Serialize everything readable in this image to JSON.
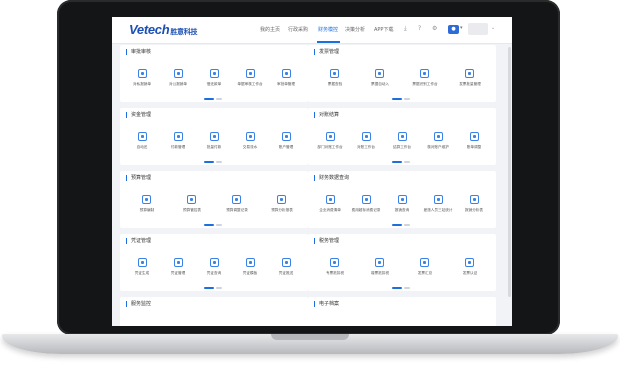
{
  "header": {
    "logo_text": "Vetech",
    "logo_cn": "胜意科技",
    "nav": [
      "我的主页",
      "行政采购",
      "财务模控",
      "决策分析",
      "APP下载"
    ],
    "active_index": 2,
    "icons": [
      "download-icon",
      "help-icon",
      "settings-icon"
    ],
    "avatar_label": "●"
  },
  "sections": [
    {
      "title": "审批审核",
      "items": [
        "对私报销单",
        "对公报销单",
        "借还款单",
        "单据审核工作台",
        "审批单管理"
      ]
    },
    {
      "title": "发票管理",
      "items": [
        "票据查验",
        "票据自动入",
        "票据识别工作台",
        "发票批量管理"
      ]
    },
    {
      "title": "资金管理",
      "items": [
        "自动还",
        "付款管理",
        "批量付款",
        "交易流水",
        "账户管理"
      ]
    },
    {
      "title": "对账结算",
      "items": [
        "部门对账工作台",
        "对账工作台",
        "结算工作台",
        "核对账户维护",
        "账单调整"
      ]
    },
    {
      "title": "预算管理",
      "items": [
        "预算编制",
        "预算管控表",
        "预算调整记录",
        "预算分析报表"
      ]
    },
    {
      "title": "财务数据查询",
      "items": [
        "企业消费清单",
        "费用超标消费记录",
        "报销查询",
        "差旅人员三站统计",
        "报销分析表"
      ]
    },
    {
      "title": "凭证管理",
      "items": [
        "凭证生成",
        "凭证管理",
        "凭证查询",
        "凭证模板",
        "凭证推送"
      ]
    },
    {
      "title": "税务管理",
      "items": [
        "专票抵扣税",
        "增票抵扣税",
        "发票汇总",
        "发票认证"
      ]
    },
    {
      "title": "服务监控",
      "items": []
    },
    {
      "title": "电子档案",
      "items": []
    }
  ],
  "floating": {
    "phone": "□",
    "support": "♫"
  },
  "colors": {
    "accent": "#1d6fe0",
    "frame": "#141516"
  }
}
